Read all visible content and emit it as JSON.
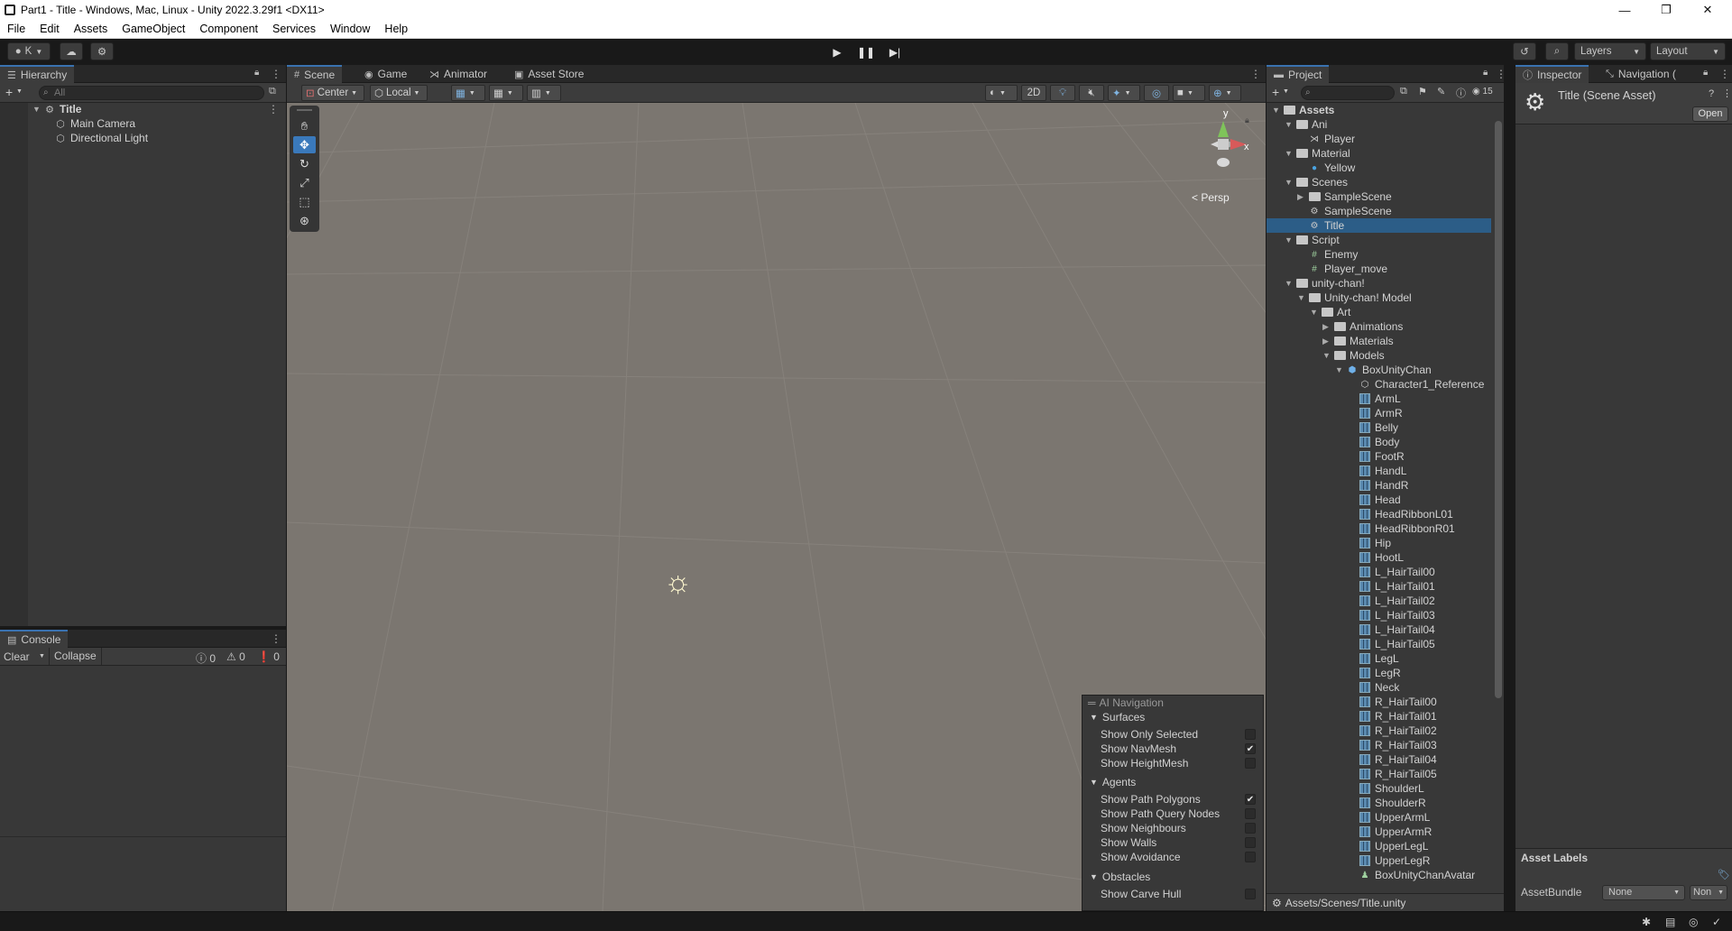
{
  "window": {
    "title": "Part1 - Title - Windows, Mac, Linux - Unity 2022.3.29f1 <DX11>",
    "controls": [
      "—",
      "❐",
      "✕"
    ]
  },
  "menu": [
    "File",
    "Edit",
    "Assets",
    "GameObject",
    "Component",
    "Services",
    "Window",
    "Help"
  ],
  "toolbar": {
    "account_label": "K",
    "layers_label": "Layers",
    "layout_label": "Layout"
  },
  "hierarchy": {
    "tab": "Hierarchy",
    "search_placeholder": "All",
    "scene": "Title",
    "items": [
      "Main Camera",
      "Directional Light"
    ]
  },
  "console": {
    "tab": "Console",
    "clear": "Clear",
    "collapse": "Collapse",
    "info_count": "0",
    "warn_count": "0",
    "error_count": "0"
  },
  "scene_view": {
    "tabs": [
      "Scene",
      "Game",
      "Animator",
      "Asset Store"
    ],
    "pivot": "Center",
    "space": "Local",
    "mode_2d": "2D",
    "gizmo_y": "y",
    "gizmo_x": "x",
    "persp": "< Persp"
  },
  "ai_navigation": {
    "title": "AI Navigation",
    "surfaces": "Surfaces",
    "surface_items": [
      {
        "label": "Show Only Selected",
        "checked": false
      },
      {
        "label": "Show NavMesh",
        "checked": true
      },
      {
        "label": "Show HeightMesh",
        "checked": false
      }
    ],
    "agents": "Agents",
    "agent_items": [
      {
        "label": "Show Path Polygons",
        "checked": true
      },
      {
        "label": "Show Path Query Nodes",
        "checked": false
      },
      {
        "label": "Show Neighbours",
        "checked": false
      },
      {
        "label": "Show Walls",
        "checked": false
      },
      {
        "label": "Show Avoidance",
        "checked": false
      }
    ],
    "obstacles": "Obstacles",
    "obstacle_items": [
      {
        "label": "Show Carve Hull",
        "checked": false
      }
    ]
  },
  "project": {
    "tab": "Project",
    "hidden_count": "15",
    "path": "Assets/Scenes/Title.unity",
    "tree": [
      {
        "label": "Assets",
        "depth": 0,
        "kind": "folder",
        "open": true,
        "bold": true
      },
      {
        "label": "Ani",
        "depth": 1,
        "kind": "folder",
        "open": true
      },
      {
        "label": "Player",
        "depth": 2,
        "kind": "anim"
      },
      {
        "label": "Material",
        "depth": 1,
        "kind": "folder",
        "open": true
      },
      {
        "label": "Yellow",
        "depth": 2,
        "kind": "material"
      },
      {
        "label": "Scenes",
        "depth": 1,
        "kind": "folder",
        "open": true
      },
      {
        "label": "SampleScene",
        "depth": 2,
        "kind": "folder",
        "closed": true
      },
      {
        "label": "SampleScene",
        "depth": 2,
        "kind": "scene"
      },
      {
        "label": "Title",
        "depth": 2,
        "kind": "scene",
        "selected": true
      },
      {
        "label": "Script",
        "depth": 1,
        "kind": "folder",
        "open": true
      },
      {
        "label": "Enemy",
        "depth": 2,
        "kind": "script"
      },
      {
        "label": "Player_move",
        "depth": 2,
        "kind": "script"
      },
      {
        "label": "unity-chan!",
        "depth": 1,
        "kind": "folder",
        "open": true
      },
      {
        "label": "Unity-chan! Model",
        "depth": 2,
        "kind": "folder",
        "open": true
      },
      {
        "label": "Art",
        "depth": 3,
        "kind": "folder",
        "open": true
      },
      {
        "label": "Animations",
        "depth": 4,
        "kind": "folder",
        "closed": true
      },
      {
        "label": "Materials",
        "depth": 4,
        "kind": "folder",
        "closed": true
      },
      {
        "label": "Models",
        "depth": 4,
        "kind": "folder",
        "open": true
      },
      {
        "label": "BoxUnityChan",
        "depth": 5,
        "kind": "model",
        "open": true
      },
      {
        "label": "Character1_Reference",
        "depth": 6,
        "kind": "prefab"
      },
      {
        "label": "ArmL",
        "depth": 6,
        "kind": "mesh"
      },
      {
        "label": "ArmR",
        "depth": 6,
        "kind": "mesh"
      },
      {
        "label": "Belly",
        "depth": 6,
        "kind": "mesh"
      },
      {
        "label": "Body",
        "depth": 6,
        "kind": "mesh"
      },
      {
        "label": "FootR",
        "depth": 6,
        "kind": "mesh"
      },
      {
        "label": "HandL",
        "depth": 6,
        "kind": "mesh"
      },
      {
        "label": "HandR",
        "depth": 6,
        "kind": "mesh"
      },
      {
        "label": "Head",
        "depth": 6,
        "kind": "mesh"
      },
      {
        "label": "HeadRibbonL01",
        "depth": 6,
        "kind": "mesh"
      },
      {
        "label": "HeadRibbonR01",
        "depth": 6,
        "kind": "mesh"
      },
      {
        "label": "Hip",
        "depth": 6,
        "kind": "mesh"
      },
      {
        "label": "HootL",
        "depth": 6,
        "kind": "mesh"
      },
      {
        "label": "L_HairTail00",
        "depth": 6,
        "kind": "mesh"
      },
      {
        "label": "L_HairTail01",
        "depth": 6,
        "kind": "mesh"
      },
      {
        "label": "L_HairTail02",
        "depth": 6,
        "kind": "mesh"
      },
      {
        "label": "L_HairTail03",
        "depth": 6,
        "kind": "mesh"
      },
      {
        "label": "L_HairTail04",
        "depth": 6,
        "kind": "mesh"
      },
      {
        "label": "L_HairTail05",
        "depth": 6,
        "kind": "mesh"
      },
      {
        "label": "LegL",
        "depth": 6,
        "kind": "mesh"
      },
      {
        "label": "LegR",
        "depth": 6,
        "kind": "mesh"
      },
      {
        "label": "Neck",
        "depth": 6,
        "kind": "mesh"
      },
      {
        "label": "R_HairTail00",
        "depth": 6,
        "kind": "mesh"
      },
      {
        "label": "R_HairTail01",
        "depth": 6,
        "kind": "mesh"
      },
      {
        "label": "R_HairTail02",
        "depth": 6,
        "kind": "mesh"
      },
      {
        "label": "R_HairTail03",
        "depth": 6,
        "kind": "mesh"
      },
      {
        "label": "R_HairTail04",
        "depth": 6,
        "kind": "mesh"
      },
      {
        "label": "R_HairTail05",
        "depth": 6,
        "kind": "mesh"
      },
      {
        "label": "ShoulderL",
        "depth": 6,
        "kind": "mesh"
      },
      {
        "label": "ShoulderR",
        "depth": 6,
        "kind": "mesh"
      },
      {
        "label": "UpperArmL",
        "depth": 6,
        "kind": "mesh"
      },
      {
        "label": "UpperArmR",
        "depth": 6,
        "kind": "mesh"
      },
      {
        "label": "UpperLegL",
        "depth": 6,
        "kind": "mesh"
      },
      {
        "label": "UpperLegR",
        "depth": 6,
        "kind": "mesh"
      },
      {
        "label": "BoxUnityChanAvatar",
        "depth": 6,
        "kind": "avatar"
      }
    ]
  },
  "inspector": {
    "tabs": [
      "Inspector",
      "Navigation ("
    ],
    "asset_title": "Title (Scene Asset)",
    "open_button": "Open",
    "asset_labels": "Asset Labels",
    "asset_bundle_label": "AssetBundle",
    "asset_bundle_value": "None",
    "asset_variant_value": "Non"
  },
  "colors": {
    "accent": "#3a79bb",
    "selection": "#2c5d87",
    "viewport": "#7b7670"
  }
}
